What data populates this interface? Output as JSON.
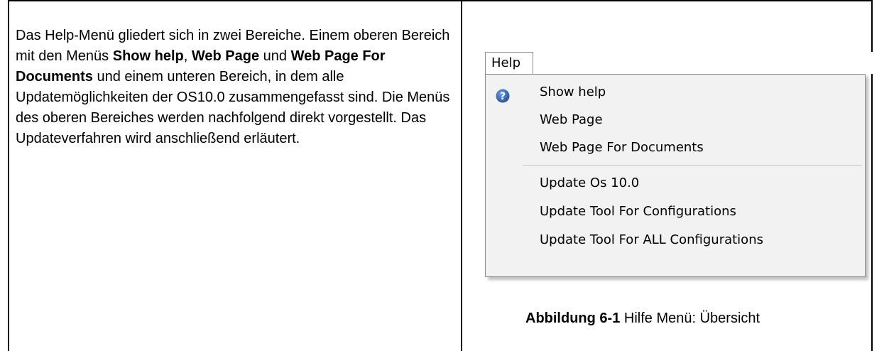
{
  "body": {
    "segments": [
      {
        "text": "Das Help-Menü gliedert sich in zwei Bereiche. Einem oberen Bereich mit den Menüs ",
        "bold": false
      },
      {
        "text": "Show help",
        "bold": true
      },
      {
        "text": ", ",
        "bold": false
      },
      {
        "text": "Web Page",
        "bold": true
      },
      {
        "text": " und ",
        "bold": false
      },
      {
        "text": "Web Page For Documents",
        "bold": true
      },
      {
        "text": " und einem unteren Bereich, in dem alle Updatemöglichkeiten der OS10.0 zusammengefasst sind. Die Menüs des oberen Bereiches werden nachfolgend direkt vorgestellt. Das Updateverfahren wird anschließend erläutert.",
        "bold": false
      }
    ]
  },
  "menu": {
    "title": "Help",
    "items": [
      {
        "label": "Show help",
        "icon": "help-question-icon"
      },
      {
        "label": "Web Page",
        "icon": ""
      },
      {
        "label": "Web Page For Documents",
        "icon": ""
      },
      {
        "label": "Update Os 10.0",
        "icon": ""
      },
      {
        "label": "Update Tool For Configurations",
        "icon": ""
      },
      {
        "label": "Update Tool For ALL Configurations",
        "icon": ""
      }
    ],
    "icon_color": "#1f4e9c"
  },
  "caption": {
    "number": "Abbildung 6-1",
    "text": " Hilfe Menü: Übersicht"
  }
}
